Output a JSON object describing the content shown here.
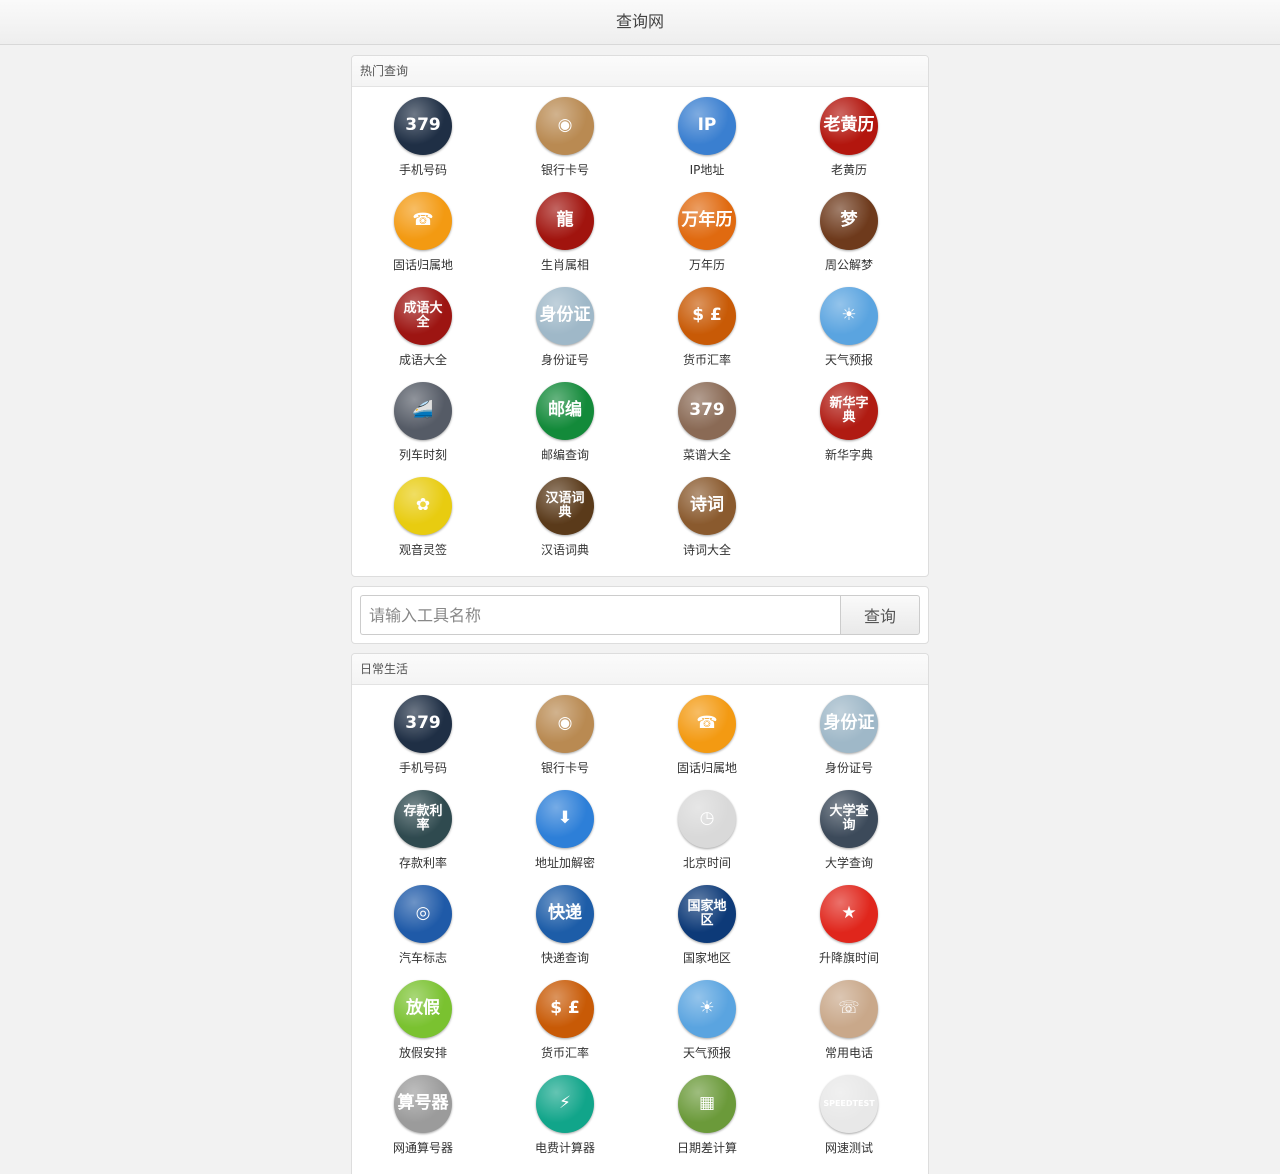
{
  "header": {
    "title": "查询网"
  },
  "hot": {
    "title": "热门查询",
    "tools": [
      {
        "label": "手机号码",
        "glyph": "379",
        "icon": "phone-number-icon",
        "color": "#1f2f45"
      },
      {
        "label": "银行卡号",
        "glyph": "◉",
        "icon": "bank-card-icon",
        "color": "#b98a52"
      },
      {
        "label": "IP地址",
        "glyph": "IP",
        "icon": "ip-address-icon",
        "color": "#3a7fd0"
      },
      {
        "label": "老黄历",
        "glyph": "老黄历",
        "icon": "old-almanac-icon",
        "color": "#b3160e"
      },
      {
        "label": "固话归属地",
        "glyph": "☎",
        "icon": "landline-icon",
        "color": "#f39a12"
      },
      {
        "label": "生肖属相",
        "glyph": "龍",
        "icon": "zodiac-icon",
        "color": "#a1140e"
      },
      {
        "label": "万年历",
        "glyph": "万年历",
        "icon": "calendar-icon",
        "color": "#e06a10"
      },
      {
        "label": "周公解梦",
        "glyph": "梦",
        "icon": "dream-icon",
        "color": "#6e3a1c"
      },
      {
        "label": "成语大全",
        "glyph": "成语大全",
        "icon": "idiom-icon",
        "color": "#9d1512"
      },
      {
        "label": "身份证号",
        "glyph": "身份证",
        "icon": "id-card-icon",
        "color": "#9fb8c8"
      },
      {
        "label": "货币汇率",
        "glyph": "$ £",
        "icon": "currency-icon",
        "color": "#c85a06"
      },
      {
        "label": "天气预报",
        "glyph": "☀",
        "icon": "weather-icon",
        "color": "#5aa4e0"
      },
      {
        "label": "列车时刻",
        "glyph": "🚄",
        "icon": "train-icon",
        "color": "#555b66"
      },
      {
        "label": "邮编查询",
        "glyph": "邮编",
        "icon": "postcode-icon",
        "color": "#138a3a"
      },
      {
        "label": "菜谱大全",
        "glyph": "379",
        "icon": "recipe-icon",
        "color": "#8a6a55"
      },
      {
        "label": "新华字典",
        "glyph": "新华字典",
        "icon": "dictionary-icon",
        "color": "#b01b12"
      },
      {
        "label": "观音灵签",
        "glyph": "✿",
        "icon": "guanyin-icon",
        "color": "#e8cc10"
      },
      {
        "label": "汉语词典",
        "glyph": "汉语词典",
        "icon": "chinese-dictionary-icon",
        "color": "#5a3a1a"
      },
      {
        "label": "诗词大全",
        "glyph": "诗词",
        "icon": "poetry-icon",
        "color": "#8a5a2e"
      }
    ]
  },
  "search": {
    "placeholder": "请输入工具名称",
    "button": "查询"
  },
  "daily": {
    "title": "日常生活",
    "tools": [
      {
        "label": "手机号码",
        "glyph": "379",
        "icon": "phone-number-icon",
        "color": "#1f2f45"
      },
      {
        "label": "银行卡号",
        "glyph": "◉",
        "icon": "bank-card-icon",
        "color": "#b98a52"
      },
      {
        "label": "固话归属地",
        "glyph": "☎",
        "icon": "landline-icon",
        "color": "#f39a12"
      },
      {
        "label": "身份证号",
        "glyph": "身份证",
        "icon": "id-card-icon",
        "color": "#9fb8c8"
      },
      {
        "label": "存款利率",
        "glyph": "存款利率",
        "icon": "deposit-rate-icon",
        "color": "#2f4a4f"
      },
      {
        "label": "地址加解密",
        "glyph": "⬇",
        "icon": "address-encrypt-icon",
        "color": "#2d7fd8"
      },
      {
        "label": "北京时间",
        "glyph": "◷",
        "icon": "clock-icon",
        "color": "#d9d9d9"
      },
      {
        "label": "大学查询",
        "glyph": "大学查询",
        "icon": "university-icon",
        "color": "#3c4a5a"
      },
      {
        "label": "汽车标志",
        "glyph": "◎",
        "icon": "car-logo-icon",
        "color": "#1f5aa8"
      },
      {
        "label": "快递查询",
        "glyph": "快递",
        "icon": "express-icon",
        "color": "#1d5da8"
      },
      {
        "label": "国家地区",
        "glyph": "国家地区",
        "icon": "country-icon",
        "color": "#0d3a78"
      },
      {
        "label": "升降旗时间",
        "glyph": "★",
        "icon": "flag-icon",
        "color": "#e0261c"
      },
      {
        "label": "放假安排",
        "glyph": "放假",
        "icon": "holiday-icon",
        "color": "#7ac230"
      },
      {
        "label": "货币汇率",
        "glyph": "$ £",
        "icon": "currency-icon",
        "color": "#c85a06"
      },
      {
        "label": "天气预报",
        "glyph": "☀",
        "icon": "weather-icon",
        "color": "#5aa4e0"
      },
      {
        "label": "常用电话",
        "glyph": "☏",
        "icon": "common-phone-icon",
        "color": "#c9a88a"
      },
      {
        "label": "网通算号器",
        "glyph": "算号器",
        "icon": "broadband-calc-icon",
        "color": "#9b9b9b"
      },
      {
        "label": "电费计算器",
        "glyph": "⚡",
        "icon": "electricity-icon",
        "color": "#11a58a"
      },
      {
        "label": "日期差计算",
        "glyph": "▦",
        "icon": "date-diff-icon",
        "color": "#6b9a3a"
      },
      {
        "label": "网速测试",
        "glyph": "SPEEDTEST",
        "icon": "speedtest-icon",
        "color": "#e8e8e8"
      }
    ]
  }
}
